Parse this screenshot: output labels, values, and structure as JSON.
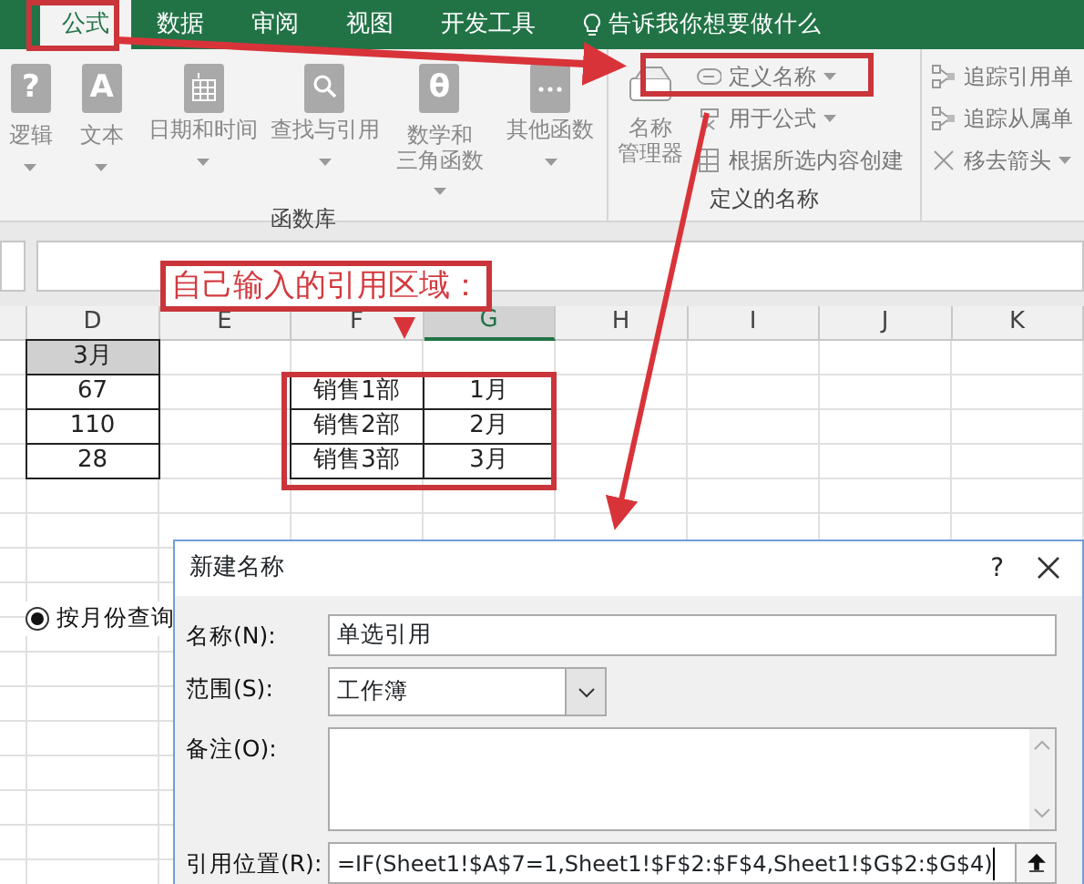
{
  "ribbon_tabs": [
    {
      "label": "公式",
      "selected": true
    },
    {
      "label": "数据",
      "selected": false
    },
    {
      "label": "审阅",
      "selected": false
    },
    {
      "label": "视图",
      "selected": false
    },
    {
      "label": "开发工具",
      "selected": false
    }
  ],
  "tell_me": "告诉我你想要做什么",
  "function_library": {
    "label": "函数库",
    "buttons": [
      {
        "label": "逻辑",
        "glyph": "?",
        "dropdown": true
      },
      {
        "label": "文本",
        "glyph": "A",
        "dropdown": true
      },
      {
        "label": "日期和时间",
        "dropdown": true
      },
      {
        "label": "查找与引用",
        "dropdown": true
      },
      {
        "label_lines": [
          "数学和",
          "三角函数"
        ],
        "glyph": "θ",
        "dropdown": true
      },
      {
        "label": "其他函数",
        "dropdown": true
      }
    ]
  },
  "defined_names": {
    "label": "定义的名称",
    "manager_lines": [
      "名称",
      "管理器"
    ],
    "items": [
      {
        "label": "定义名称",
        "dropdown": true
      },
      {
        "label": "用于公式",
        "dropdown": true
      },
      {
        "label": "根据所选内容创建",
        "dropdown": false
      }
    ]
  },
  "formula_auditing": {
    "items": [
      {
        "label": "追踪引用单",
        "dropdown": false
      },
      {
        "label": "追踪从属单",
        "dropdown": false
      },
      {
        "label": "移去箭头",
        "dropdown": true
      }
    ]
  },
  "annotation": "自己输入的引用区域：",
  "sheet": {
    "columns": [
      {
        "label": "D",
        "selected": false
      },
      {
        "label": "E",
        "selected": false
      },
      {
        "label": "F",
        "selected": false
      },
      {
        "label": "G",
        "selected": true
      },
      {
        "label": "H",
        "selected": false
      },
      {
        "label": "I",
        "selected": false
      },
      {
        "label": "J",
        "selected": false
      },
      {
        "label": "K",
        "selected": false
      }
    ],
    "rows": [
      [
        {
          "text": "3月",
          "shaded": true
        }
      ],
      [
        {
          "text": "67",
          "shaded": false
        },
        {
          "text": ""
        },
        {
          "text": "销售1部",
          "shaded": false
        },
        {
          "text": "1月",
          "shaded": false
        }
      ],
      [
        {
          "text": "110",
          "shaded": false
        },
        {
          "text": ""
        },
        {
          "text": "销售2部",
          "shaded": false
        },
        {
          "text": "2月",
          "shaded": false
        }
      ],
      [
        {
          "text": "28",
          "shaded": false
        },
        {
          "text": ""
        },
        {
          "text": "销售3部",
          "shaded": false
        },
        {
          "text": "3月",
          "shaded": false
        }
      ]
    ]
  },
  "radio": {
    "label": "按月份查询",
    "selected": true
  },
  "dialog": {
    "title": "新建名称",
    "help": "?",
    "fields": [
      {
        "label": "名称(N):",
        "kind": "text",
        "value": "单选引用"
      },
      {
        "label": "范围(S):",
        "kind": "select",
        "value": "工作簿"
      },
      {
        "label": "备注(O):",
        "kind": "textarea"
      },
      {
        "label": "引用位置(R):",
        "kind": "reference",
        "value": "=IF(Sheet1!$A$7=1,Sheet1!$F$2:$F$4,Sheet1!$G$2:$G$4)"
      }
    ]
  }
}
